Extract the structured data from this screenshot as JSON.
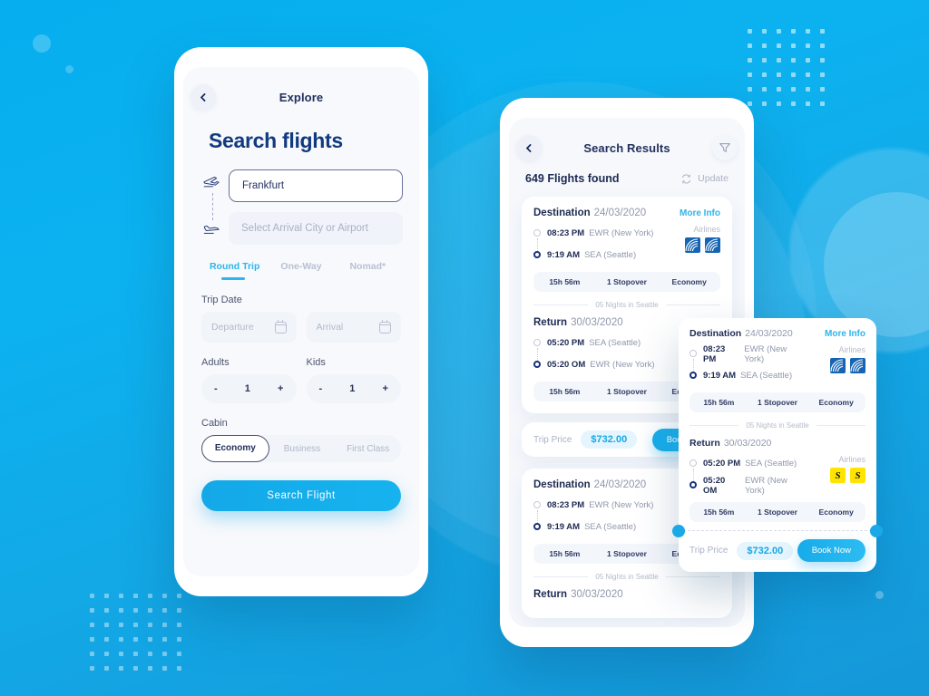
{
  "theme": {
    "accent": "#2cb4ec",
    "navy": "#1e2a52",
    "bg_from": "#06aeef",
    "bg_to": "#1597d8",
    "yellow": "#ffe400"
  },
  "left_phone": {
    "nav": {
      "back_icon": "chevron-left-icon",
      "title": "Explore"
    },
    "heading": "Search flights",
    "departure_field": {
      "value": "Frankfurt",
      "icon": "plane-takeoff-icon"
    },
    "arrival_field": {
      "placeholder": "Select Arrival City or Airport",
      "icon": "plane-landing-icon"
    },
    "trip_tabs": [
      {
        "label": "Round Trip",
        "active": true
      },
      {
        "label": "One-Way",
        "active": false
      },
      {
        "label": "Nomad*",
        "active": false
      }
    ],
    "trip_date": {
      "label": "Trip Date",
      "departure_placeholder": "Departure",
      "arrival_placeholder": "Arrival",
      "calendar_icon": "calendar-icon"
    },
    "passengers": {
      "adults_label": "Adults",
      "kids_label": "Kids",
      "adults_value": "1",
      "kids_value": "1",
      "minus": "-",
      "plus": "+"
    },
    "cabin": {
      "label": "Cabin",
      "options": [
        {
          "label": "Economy",
          "selected": true
        },
        {
          "label": "Business",
          "selected": false
        },
        {
          "label": "First Class",
          "selected": false
        }
      ]
    },
    "search_button": "Search Flight"
  },
  "mid_phone": {
    "nav": {
      "back_icon": "chevron-left-icon",
      "title": "Search Results",
      "filter_icon": "filter-funnel-icon"
    },
    "results_count": "649 Flights found",
    "update": {
      "label": "Update",
      "icon": "refresh-icon"
    },
    "card1": {
      "outbound": {
        "title": "Destination",
        "date": "24/03/2020",
        "more_info": "More Info",
        "depart_time": "08:23 PM",
        "depart_airport": "EWR (New York)",
        "arrive_time": "9:19 AM",
        "arrive_airport": "SEA (Seattle)",
        "airlines_label": "Airlines",
        "chips": [
          "15h 56m",
          "1 Stopover",
          "Economy"
        ]
      },
      "nights": "05 Nights in Seattle",
      "return": {
        "title": "Return",
        "date": "30/03/2020",
        "depart_time": "05:20 PM",
        "depart_airport": "SEA (Seattle)",
        "arrive_time": "05:20 OM",
        "arrive_airport": "EWR (New York)",
        "chips": [
          "15h 56m",
          "1 Stopover",
          "Economy"
        ]
      },
      "price_label": "Trip Price",
      "price": "$732.00",
      "book_label": "Book Now"
    },
    "card2": {
      "outbound": {
        "title": "Destination",
        "date": "24/03/2020",
        "depart_time": "08:23 PM",
        "depart_airport": "EWR (New York)",
        "arrive_time": "9:19 AM",
        "arrive_airport": "SEA (Seattle)",
        "chips": [
          "15h 56m",
          "1 Stopover",
          "Economy"
        ]
      },
      "nights": "05 Nights in Seattle",
      "return": {
        "title": "Return",
        "date": "30/03/2020"
      }
    }
  },
  "float_card": {
    "outbound": {
      "title": "Destination",
      "date": "24/03/2020",
      "more_info": "More Info",
      "depart_time": "08:23 PM",
      "depart_airport": "EWR (New York)",
      "arrive_time": "9:19 AM",
      "arrive_airport": "SEA (Seattle)",
      "airlines_label": "Airlines",
      "chips": [
        "15h 56m",
        "1 Stopover",
        "Economy"
      ]
    },
    "nights": "05 Nights in Seattle",
    "return": {
      "title": "Return",
      "date": "30/03/2020",
      "depart_time": "05:20 PM",
      "depart_airport": "SEA (Seattle)",
      "arrive_time": "05:20 OM",
      "arrive_airport": "EWR (New York)",
      "airlines_label": "Airlines",
      "airline_logo_text": "S",
      "chips": [
        "15h 56m",
        "1 Stopover",
        "Economy"
      ]
    },
    "price_label": "Trip Price",
    "price": "$732.00",
    "book_label": "Book Now"
  }
}
